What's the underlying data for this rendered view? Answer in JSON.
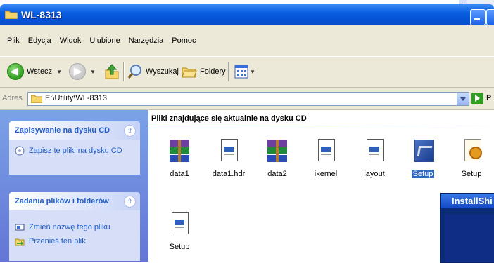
{
  "window": {
    "title": "WL-8313"
  },
  "menu": [
    "Plik",
    "Edycja",
    "Widok",
    "Ulubione",
    "Narzędzia",
    "Pomoc"
  ],
  "toolbar": {
    "back_label": "Wstecz",
    "search_label": "Wyszukaj",
    "folders_label": "Foldery"
  },
  "address": {
    "label": "Adres",
    "value": "E:\\Utility\\WL-8313",
    "go_label": "P"
  },
  "taskpane": {
    "cd_panel": {
      "title": "Zapisywanie na dysku CD",
      "tasks": [
        "Zapisz te pliki na dysku CD"
      ]
    },
    "files_panel": {
      "title": "Zadania plików i folderów",
      "tasks": [
        "Zmień nazwę tego pliku",
        "Przenieś ten plik"
      ]
    }
  },
  "content": {
    "group_title": "Pliki znajdujące się aktualnie na dysku CD",
    "files": [
      {
        "name": "data1",
        "icon": "archive-icon"
      },
      {
        "name": "data1.hdr",
        "icon": "document-icon"
      },
      {
        "name": "data2",
        "icon": "archive-icon"
      },
      {
        "name": "ikernel",
        "icon": "document-icon"
      },
      {
        "name": "layout",
        "icon": "document-icon"
      },
      {
        "name": "Setup",
        "icon": "installer-icon",
        "selected": true
      },
      {
        "name": "Setup",
        "icon": "setup-gear-icon"
      },
      {
        "name": "Setup",
        "icon": "document-icon"
      }
    ]
  },
  "overlay": {
    "title": "InstallShi"
  },
  "colors": {
    "titlebar": "#0a5ee0",
    "taskpane": "#6e8ee0",
    "link": "#215dc6",
    "selection": "#316ac5"
  }
}
